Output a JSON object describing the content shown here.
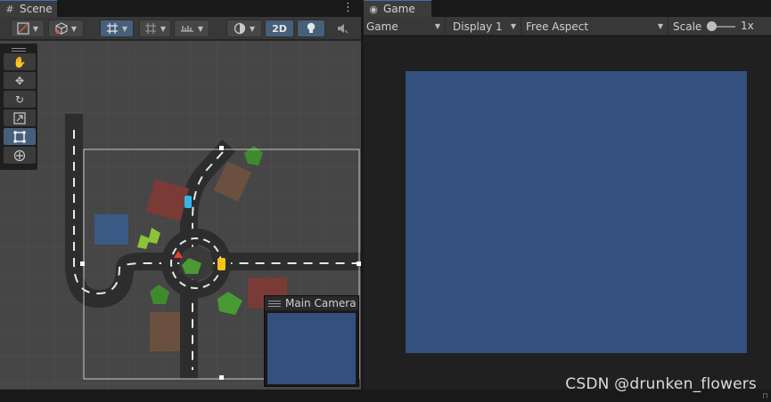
{
  "scene": {
    "tab_title": "Scene",
    "tab_icon": "grid-icon",
    "toolbar": {
      "mode_2d": "2D"
    },
    "tools": [
      "hand-tool",
      "move-tool",
      "rotate-tool",
      "scale-tool",
      "rect-tool",
      "transform-tool"
    ],
    "active_tool": "rect-tool",
    "camera_preview_title": "Main Camera"
  },
  "game": {
    "tab_title": "Game",
    "tab_icon": "gamepad-icon",
    "display_mode": "Game",
    "display": "Display 1",
    "aspect": "Free Aspect",
    "scale_label": "Scale",
    "scale_value": "1x",
    "background_color": "#33507e"
  },
  "watermark": "CSDN @drunken_flowers"
}
